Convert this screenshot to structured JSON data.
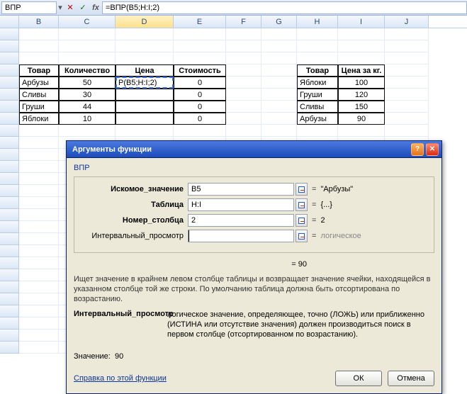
{
  "formula_bar": {
    "name_box": "ВПР",
    "formula": "=ВПР(B5;H:I;2)"
  },
  "columns": [
    "B",
    "C",
    "D",
    "E",
    "F",
    "G",
    "H",
    "I",
    "J"
  ],
  "active_column": "D",
  "tables": {
    "main": {
      "headers": {
        "tovar": "Товар",
        "qty": "Количество",
        "price": "Цена",
        "cost": "Стоимость"
      },
      "rows": [
        {
          "tovar": "Арбузы",
          "qty": "50",
          "price": "Р(B5;H:I;2)",
          "cost": "0"
        },
        {
          "tovar": "Сливы",
          "qty": "30",
          "price": "",
          "cost": "0"
        },
        {
          "tovar": "Груши",
          "qty": "44",
          "price": "",
          "cost": "0"
        },
        {
          "tovar": "Яблоки",
          "qty": "10",
          "price": "",
          "cost": "0"
        }
      ]
    },
    "lookup": {
      "headers": {
        "tovar": "Товар",
        "ppkg": "Цена за кг."
      },
      "rows": [
        {
          "tovar": "Яблоки",
          "ppkg": "100"
        },
        {
          "tovar": "Груши",
          "ppkg": "120"
        },
        {
          "tovar": "Сливы",
          "ppkg": "150"
        },
        {
          "tovar": "Арбузы",
          "ppkg": "90"
        }
      ]
    }
  },
  "dialog": {
    "title": "Аргументы функции",
    "func": "ВПР",
    "fields": {
      "lookup_label": "Искомое_значение",
      "lookup_val": "B5",
      "lookup_res": "\"Арбузы\"",
      "table_label": "Таблица",
      "table_val": "H:I",
      "table_res": "{...}",
      "col_label": "Номер_столбца",
      "col_val": "2",
      "col_res": "2",
      "range_label": "Интервальный_просмотр",
      "range_val": "",
      "range_res": "логическое"
    },
    "preview_eq": "= 90",
    "desc_main": "Ищет значение в крайнем левом столбце таблицы и возвращает значение ячейки, находящейся в указанном столбце той же строки. По умолчанию таблица должна быть отсортирована по возрастанию.",
    "desc_arg_label": "Интервальный_просмотр",
    "desc_arg_text": "логическое значение, определяющее, точно (ЛОЖЬ) или приближенно (ИСТИНА или отсутствие значения) должен производиться поиск в первом столбце (отсортированном по возрастанию).",
    "result_label": "Значение:",
    "result_value": "90",
    "help_link": "Справка по этой функции",
    "ok": "ОК",
    "cancel": "Отмена"
  }
}
